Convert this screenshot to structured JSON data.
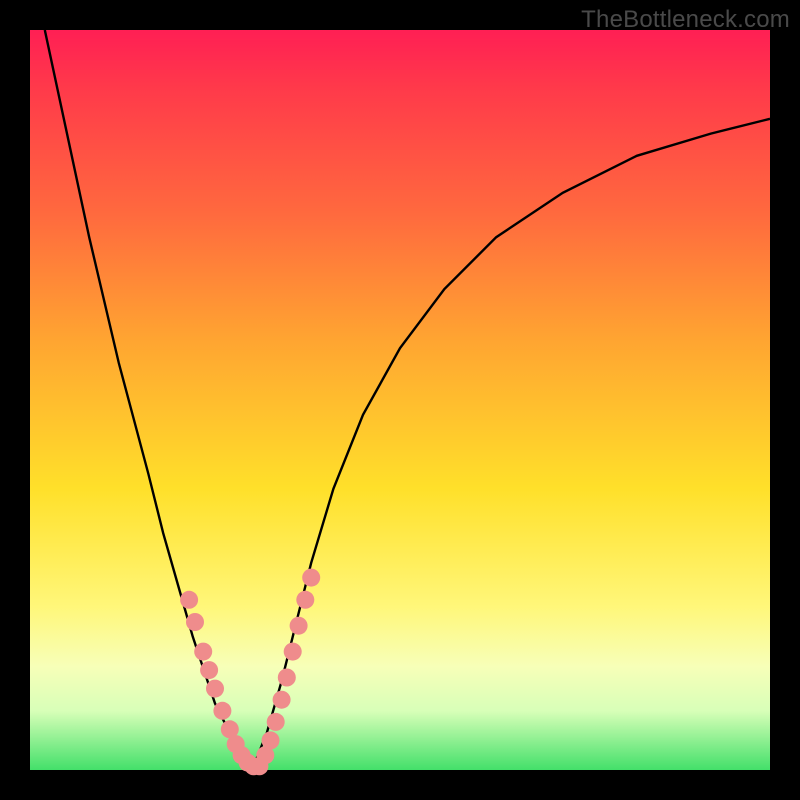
{
  "branding": "TheBottleneck.com",
  "chart_data": {
    "type": "line",
    "title": "",
    "xlabel": "",
    "ylabel": "",
    "xlim": [
      0,
      100
    ],
    "ylim": [
      0,
      100
    ],
    "series": [
      {
        "name": "left-branch",
        "x": [
          2,
          5,
          8,
          12,
          16,
          18,
          20,
          22,
          24,
          25,
          26,
          27,
          28,
          29,
          30
        ],
        "y": [
          100,
          86,
          72,
          55,
          40,
          32,
          25,
          18,
          12,
          9,
          7,
          5,
          3,
          1.5,
          0
        ]
      },
      {
        "name": "right-branch",
        "x": [
          30,
          32,
          34,
          36,
          38,
          41,
          45,
          50,
          56,
          63,
          72,
          82,
          92,
          100
        ],
        "y": [
          0,
          5,
          12,
          20,
          28,
          38,
          48,
          57,
          65,
          72,
          78,
          83,
          86,
          88
        ]
      }
    ],
    "markers": {
      "name": "dots",
      "color": "#ef8c8c",
      "radius": 9,
      "points": [
        {
          "x": 21.5,
          "y": 23
        },
        {
          "x": 22.3,
          "y": 20
        },
        {
          "x": 23.4,
          "y": 16
        },
        {
          "x": 24.2,
          "y": 13.5
        },
        {
          "x": 25.0,
          "y": 11
        },
        {
          "x": 26.0,
          "y": 8
        },
        {
          "x": 27.0,
          "y": 5.5
        },
        {
          "x": 27.8,
          "y": 3.5
        },
        {
          "x": 28.6,
          "y": 2
        },
        {
          "x": 29.4,
          "y": 1
        },
        {
          "x": 30.2,
          "y": 0.5
        },
        {
          "x": 31.0,
          "y": 0.5
        },
        {
          "x": 31.8,
          "y": 2
        },
        {
          "x": 32.5,
          "y": 4
        },
        {
          "x": 33.2,
          "y": 6.5
        },
        {
          "x": 34.0,
          "y": 9.5
        },
        {
          "x": 34.7,
          "y": 12.5
        },
        {
          "x": 35.5,
          "y": 16
        },
        {
          "x": 36.3,
          "y": 19.5
        },
        {
          "x": 37.2,
          "y": 23
        },
        {
          "x": 38.0,
          "y": 26
        }
      ]
    }
  }
}
